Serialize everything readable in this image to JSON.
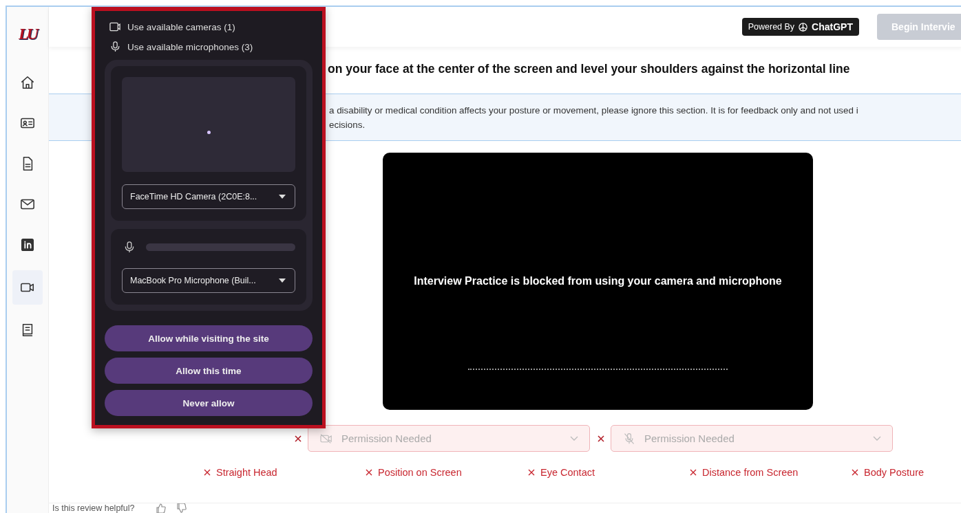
{
  "logo": "LU",
  "sidebar": {
    "items": [
      {
        "selected": false
      },
      {
        "selected": false
      },
      {
        "selected": false
      },
      {
        "selected": false
      },
      {
        "selected": false
      },
      {
        "selected": true
      },
      {
        "selected": false
      }
    ]
  },
  "header": {
    "powered_by": "Powered By",
    "brand": "ChatGPT",
    "begin_button": {
      "label": "Begin Intervie",
      "disabled": true
    }
  },
  "instruction": "on your face at the center of the screen and level your shoulders against the horizontal line",
  "notice_lines": [
    "a disability or medical condition affects your posture or movement, please ignore this section. It is for feedback only and not used i",
    "ecisions."
  ],
  "video": {
    "message": "Interview Practice is blocked from using your camera and microphone"
  },
  "permissions": [
    {
      "kind": "camera",
      "placeholder": "Permission Needed",
      "granted": false
    },
    {
      "kind": "microphone",
      "placeholder": "Permission Needed",
      "granted": false
    }
  ],
  "criteria": [
    {
      "label": "Straight Head",
      "met": false
    },
    {
      "label": "Position on Screen",
      "met": false
    },
    {
      "label": "Eye Contact",
      "met": false
    },
    {
      "label": "Distance from Screen",
      "met": false
    },
    {
      "label": "Body Posture",
      "met": false
    }
  ],
  "footer": {
    "question": "Is this review helpful?"
  },
  "popup": {
    "camera_line": "Use available cameras (1)",
    "mic_line": "Use available microphones (3)",
    "camera_select": "FaceTime HD Camera (2C0E:8...",
    "mic_meter": {
      "level": 0
    },
    "mic_select": "MacBook Pro Microphone (Buil...",
    "buttons": [
      "Allow while visiting the site",
      "Allow this time",
      "Never allow"
    ]
  }
}
